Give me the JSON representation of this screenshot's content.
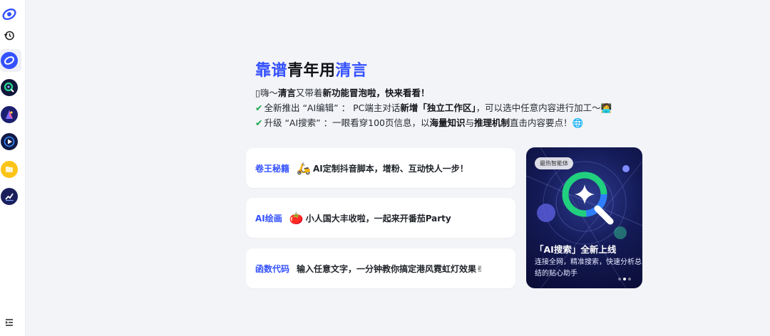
{
  "sidebar": {
    "icons": [
      {
        "name": "chatglm-logo-icon",
        "color": "#3451ff"
      },
      {
        "name": "history-icon"
      },
      {
        "name": "qingyan-agent-icon",
        "color": "#3451ff"
      },
      {
        "name": "search-agent-icon"
      },
      {
        "name": "drawing-agent-icon"
      },
      {
        "name": "video-agent-icon"
      },
      {
        "name": "folder-agent-icon",
        "color": "#f5b50a"
      },
      {
        "name": "chart-agent-icon"
      },
      {
        "name": "menu-collapse-icon"
      }
    ]
  },
  "hero": {
    "title_a": "靠谱",
    "title_b": "青年用",
    "title_c": "清言",
    "line1_prefix": "嗨～",
    "line1_bold1": "清言",
    "line1_mid": "又带着",
    "line1_bold2": "新功能冒泡啦，快来看看！",
    "line2_a": "全新推出 “AI编辑” ： PC端主对话",
    "line2_bold": "新增「独立工作区」",
    "line2_b": "，可以选中任意内容进行加工～",
    "line2_emoji": "🧑‍💻",
    "line3_a": "升级 “AI搜索” ：一眼看穿100页信息，以",
    "line3_bold1": "海量知识",
    "line3_mid": "与",
    "line3_bold2": "推理机制",
    "line3_b": "直击内容要点！",
    "line3_emoji": "🌐"
  },
  "cards": [
    {
      "label": "卷王秘籍",
      "emoji": "🛵",
      "text": "AI定制抖音脚本，增粉、互动快人一步！"
    },
    {
      "label": "AI绘画",
      "emoji": "🍅",
      "text": "小人国大丰收啦，一起来开番茄Party"
    },
    {
      "label": "函数代码",
      "emoji": "",
      "text": "输入任意文字，一分钟教你搞定港风霓虹灯效果✌"
    }
  ],
  "promo": {
    "badge": "最热智能体",
    "title": "「AI搜索」全新上线",
    "desc": "连接全网，精准搜索，快速分析总结的贴心助手",
    "slides": 3,
    "active_slide": 1
  },
  "colors": {
    "accent": "#3451ff",
    "check": "#1ca64a"
  }
}
